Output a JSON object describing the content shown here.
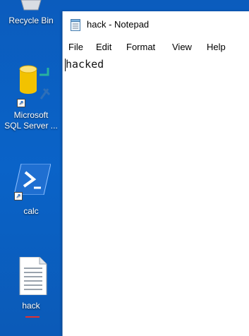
{
  "desktop": {
    "icons": [
      {
        "label": "Recycle Bin",
        "name": "recycle-bin"
      },
      {
        "label": "Microsoft SQL Server ...",
        "line1": "Microsoft",
        "line2": "SQL Server ...",
        "name": "sql-server"
      },
      {
        "label": "calc",
        "name": "calc"
      },
      {
        "label": "hack",
        "name": "hack-file"
      }
    ]
  },
  "notepad": {
    "title": "hack - Notepad",
    "menu": [
      "File",
      "Edit",
      "Format",
      "View",
      "Help"
    ],
    "content": "hacked"
  },
  "colors": {
    "desktop_bg": "#0a63c8",
    "powershell_blue": "#1f6fd1",
    "sql_yellow": "#f2c200"
  }
}
